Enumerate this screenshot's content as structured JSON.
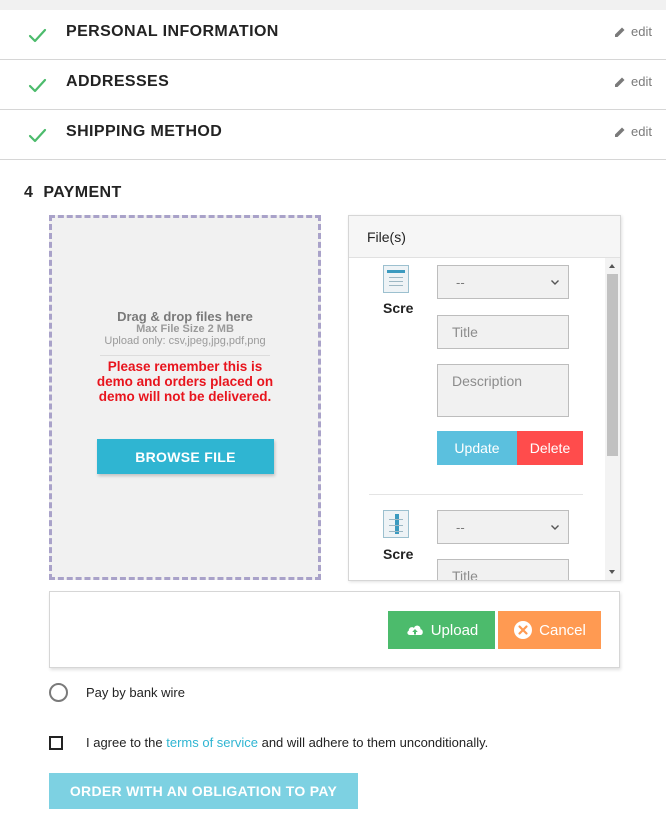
{
  "steps": [
    {
      "title": "PERSONAL INFORMATION",
      "edit_label": "edit"
    },
    {
      "title": "ADDRESSES",
      "edit_label": "edit"
    },
    {
      "title": "SHIPPING METHOD",
      "edit_label": "edit"
    }
  ],
  "payment": {
    "number": "4",
    "title": "PAYMENT"
  },
  "dropzone": {
    "title": "Drag & drop files here",
    "max_size": "Max File Size 2 MB",
    "allowed": "Upload only: csv,jpeg,jpg,pdf,png",
    "warning": "Please remember this is demo and orders placed on demo will not be delivered.",
    "browse_label": "BROWSE FILE"
  },
  "files_panel": {
    "header": "File(s)",
    "items": [
      {
        "name": "Scre",
        "select_value": "--",
        "title_placeholder": "Title",
        "description_placeholder": "Description",
        "update_label": "Update",
        "delete_label": "Delete"
      },
      {
        "name": "Scre",
        "select_value": "--",
        "title_placeholder": "Title"
      }
    ]
  },
  "upload_bar": {
    "upload_label": "Upload",
    "cancel_label": "Cancel"
  },
  "payment_option": {
    "label": "Pay by bank wire"
  },
  "terms": {
    "prefix": "I agree to the ",
    "link": "terms of service",
    "suffix": " and will adhere to them unconditionally."
  },
  "order_button": "ORDER WITH AN OBLIGATION TO PAY",
  "colors": {
    "check": "#4cbb6c",
    "accent": "#2fb5d2",
    "danger": "#ff4c4c",
    "warning_text": "#e8141d",
    "upload": "#4cbb6c",
    "cancel": "#ff9a52"
  }
}
